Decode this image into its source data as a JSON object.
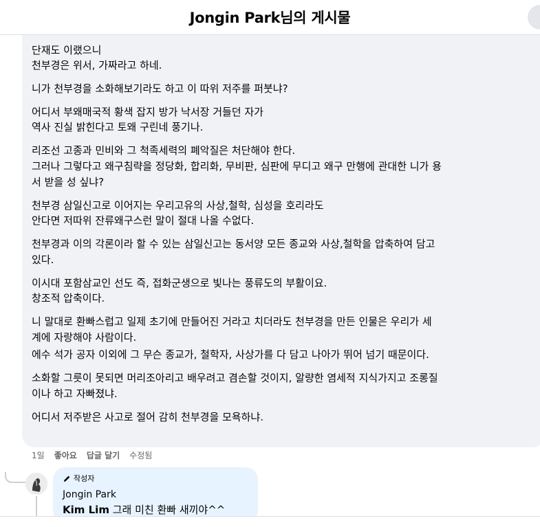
{
  "header": {
    "title": "Jongin Park님의 게시물"
  },
  "comment": {
    "paragraphs": [
      [
        "단재도 이랬으니",
        "천부경은 위서, 가짜라고 하네."
      ],
      [
        "니가 천부경을 소화해보기라도 하고 이 따위 저주를 퍼붓냐?"
      ],
      [
        "어디서 부왜매국적 황색 잡지 방가 낙서장 거들던 자가",
        "역사 진실 밝힌다고 토왜 구린네 풍기나."
      ],
      [
        "리조선 고종과 민비와 그 척족세력의 폐악질은 처단해야 한다.",
        "그러나 그렇다고 왜구침략을 정당화, 합리화, 무비판, 심판에 무디고 왜구 만행에 관대한 니가 용",
        "서 받을 성 싶냐?"
      ],
      [
        "천부경 삼일신고로 이어지는 우리고유의 사상,철학, 심성을 호리라도",
        "안다면 저따위 잔류왜구스런 말이 절대 나올 수없다."
      ],
      [
        "천부경과 이의 각론이라 할 수 있는 삼일신고는 동서양 모든 종교와 사상,철학을 압축하여 담고",
        "있다."
      ],
      [
        "이시대 포함삼교인 선도 즉, 접화군생으로 빛나는 풍류도의 부활이요.",
        "창조적 압축이다."
      ],
      [
        "니 말대로 환빠스럽고 일제 초기에 만들어진 거라고 치더라도 천부경을 만든 인물은 우리가 세",
        "계에 자랑해야 사람이다.",
        "에수 석가 공자 이외에 그 무슨 종교가, 철학자, 사상가를 다 담고 나아가 뛰어 넘기 때문이다."
      ],
      [
        "소화할 그릇이 못되면 머리조아리고 배우려고 겸손할 것이지, 알량한 염세적 지식가지고 조롱질",
        "이나 하고 자빠졌냐."
      ],
      [
        "어디서 저주받은 사고로 절어 감히 천부경을 모욕하냐."
      ]
    ],
    "actions": {
      "time": "1일",
      "like": "좋아요",
      "reply": "답글 달기",
      "edited": "수정됨"
    }
  },
  "reply": {
    "badge": "작성자",
    "name": "Jongin Park",
    "mention": "Kim Lim",
    "text": " 그래 미친 환빠 새끼야^^"
  }
}
